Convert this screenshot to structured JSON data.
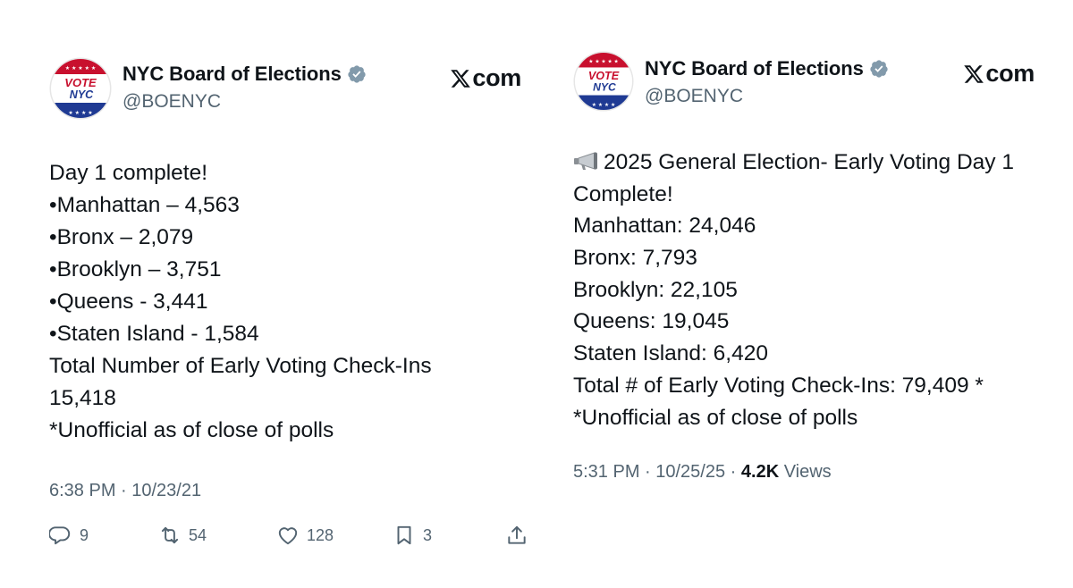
{
  "tweets": [
    {
      "author": {
        "name": "NYC Board of Elections",
        "handle": "@BOENYC",
        "logo_top": "VOTE",
        "logo_bottom": "NYC"
      },
      "source": "com",
      "lines": [
        "Day 1 complete!",
        "•Manhattan – 4,563",
        "•Bronx – 2,079",
        "•Brooklyn – 3,751",
        "•Queens - 3,441",
        "•Staten Island - 1,584",
        "Total Number of Early Voting Check-Ins",
        "15,418",
        "*Unofficial as of close of polls"
      ],
      "timestamp": "6:38 PM · 10/23/21",
      "actions": {
        "replies": "9",
        "retweets": "54",
        "likes": "128",
        "bookmarks": "3"
      }
    },
    {
      "author": {
        "name": "NYC Board of Elections",
        "handle": "@BOENYC",
        "logo_top": "VOTE",
        "logo_bottom": "NYC"
      },
      "source": "com",
      "first_line": "2025 General Election- Early Voting Day 1",
      "lines": [
        "Complete!",
        "Manhattan: 24,046",
        "Bronx: 7,793",
        "Brooklyn: 22,105",
        "Queens: 19,045",
        "Staten Island: 6,420",
        "Total # of Early Voting Check-Ins: 79,409 *",
        "*Unofficial as of close of polls"
      ],
      "timestamp": "5:31 PM · 10/25/25 · ",
      "views_count": "4.2K",
      "views_label": " Views"
    }
  ],
  "colors": {
    "text": "#0f1419",
    "secondary": "#536471",
    "verified": "#829aab",
    "logo_red": "#c8102e",
    "logo_blue": "#1f3a93"
  },
  "icons": {
    "verified": "verified-badge-icon",
    "x_logo": "x-logo-icon",
    "megaphone": "megaphone-emoji",
    "reply": "reply-icon",
    "retweet": "retweet-icon",
    "like": "heart-icon",
    "bookmark": "bookmark-icon",
    "share": "share-icon"
  }
}
